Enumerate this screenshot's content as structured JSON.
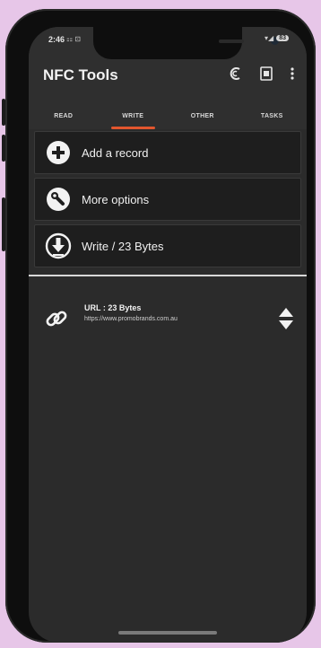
{
  "status": {
    "time": "2:46",
    "left_icons": "⚏ ⊡",
    "right_icons": "▾◢",
    "battery": "83"
  },
  "app": {
    "title": "NFC Tools",
    "actions": [
      "nfc-reader-icon",
      "tag-icon",
      "more-vert-icon"
    ]
  },
  "tabs": [
    {
      "label": "READ"
    },
    {
      "label": "WRITE",
      "active": true
    },
    {
      "label": "OTHER"
    },
    {
      "label": "TASKS"
    }
  ],
  "actions": [
    {
      "icon": "add-circle-icon",
      "label": "Add a record"
    },
    {
      "icon": "settings-wrench-icon",
      "label": "More options"
    },
    {
      "icon": "write-download-icon",
      "label": "Write / 23 Bytes"
    }
  ],
  "record": {
    "icon": "link-icon",
    "title": "URL : 23 Bytes",
    "url": "https://www.promobrands.com.au"
  },
  "colors": {
    "accent": "#e2562e",
    "background": "#2b2b2b",
    "bezel": "#0e0e0e",
    "page_bg": "#e7c6e8"
  }
}
